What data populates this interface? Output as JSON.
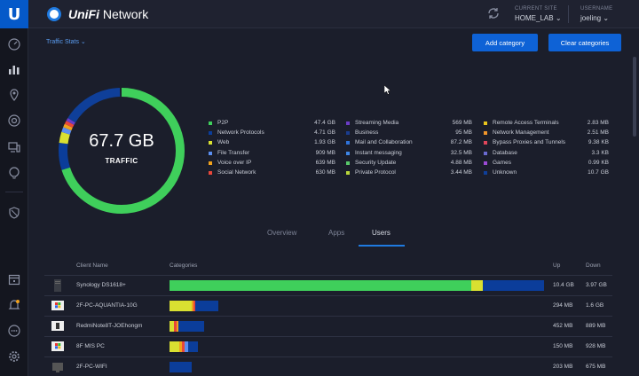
{
  "nav": {
    "logo": "U",
    "icons": [
      "dashboard-icon",
      "statistics-icon",
      "map-icon",
      "devices-icon",
      "clients-icon",
      "insights-icon",
      "shield-icon",
      "events-icon",
      "alerts-icon",
      "chat-icon",
      "settings-icon"
    ]
  },
  "topbar": {
    "brand_italic": "UniFi",
    "brand_rest": " Network",
    "site_label": "CURRENT SITE",
    "site_value": "HOME_LAB",
    "user_label": "USERNAME",
    "user_value": "joeling"
  },
  "subhead": {
    "stats_dropdown": "Traffic Stats",
    "add_category": "Add category",
    "clear_categories": "Clear categories"
  },
  "donut": {
    "total": "67.7 GB",
    "label": "TRAFFIC"
  },
  "colors": {
    "p2p": "#3fcf5b",
    "network_protocols": "#0b3d9a",
    "web": "#d9e031",
    "file_transfer": "#5a8ef0",
    "voice_over_ip": "#f0a11c",
    "social_network": "#e8473a",
    "streaming_media": "#6b3cc6",
    "business": "#5a2cb8",
    "mail": "#2e72d9",
    "instant_messaging": "#3e86e6",
    "security_update": "#58c86a",
    "private_protocol": "#b8d63a",
    "remote_access": "#e8c41c",
    "network_management": "#f0952a",
    "bypass_proxies": "#e0455a",
    "database": "#6a6ad0",
    "games": "#9c4ad6",
    "unknown": "#0f3f99"
  },
  "legend": [
    [
      {
        "name": "P2P",
        "value": "47.4 GB",
        "color": "#3fcf5b"
      },
      {
        "name": "Network Protocols",
        "value": "4.71 GB",
        "color": "#0b3d9a"
      },
      {
        "name": "Web",
        "value": "1.93 GB",
        "color": "#d9e031"
      },
      {
        "name": "File Transfer",
        "value": "909 MB",
        "color": "#5a8ef0"
      },
      {
        "name": "Voice over IP",
        "value": "639 MB",
        "color": "#f0a11c"
      },
      {
        "name": "Social Network",
        "value": "630 MB",
        "color": "#e8473a"
      }
    ],
    [
      {
        "name": "Streaming Media",
        "value": "569 MB",
        "color": "#6b3cc6"
      },
      {
        "name": "Business",
        "value": "95 MB",
        "color": "#1a3c8e"
      },
      {
        "name": "Mail and Collaboration",
        "value": "87.2 MB",
        "color": "#2e72d9"
      },
      {
        "name": "Instant messaging",
        "value": "32.5 MB",
        "color": "#3e86e6"
      },
      {
        "name": "Security Update",
        "value": "4.88 MB",
        "color": "#58c86a"
      },
      {
        "name": "Private Protocol",
        "value": "3.44 MB",
        "color": "#b8d63a"
      }
    ],
    [
      {
        "name": "Remote Access Terminals",
        "value": "2.83 MB",
        "color": "#e8c41c"
      },
      {
        "name": "Network Management",
        "value": "2.51 MB",
        "color": "#f0952a"
      },
      {
        "name": "Bypass Proxies and Tunnels",
        "value": "9.38 KB",
        "color": "#e0455a"
      },
      {
        "name": "Database",
        "value": "3.3 KB",
        "color": "#6a6ad0"
      },
      {
        "name": "Games",
        "value": "0.99 KB",
        "color": "#9c4ad6"
      },
      {
        "name": "Unknown",
        "value": "10.7 GB",
        "color": "#0f3f99"
      }
    ]
  ],
  "tabs": [
    "Overview",
    "Apps",
    "Users"
  ],
  "active_tab": "Users",
  "table": {
    "headers": {
      "client": "Client Name",
      "categories": "Categories",
      "up": "Up",
      "down": "Down"
    },
    "rows": [
      {
        "name": "Synology DS1618+",
        "up": "10.4 GB",
        "down": "3.97 GB",
        "segments": [
          {
            "color": "#3fcf5b",
            "share": 0.806
          },
          {
            "color": "#d9e031",
            "share": 0.03
          },
          {
            "color": "#0b3d9a",
            "share": 0.164
          }
        ],
        "length": 1.0
      },
      {
        "name": "2F-PC-AQUANTIA-10G",
        "up": "294 MB",
        "down": "1.6 GB",
        "segments": [
          {
            "color": "#d9e031",
            "share": 0.45
          },
          {
            "color": "#f0a11c",
            "share": 0.04
          },
          {
            "color": "#e8473a",
            "share": 0.04
          },
          {
            "color": "#0b3d9a",
            "share": 0.47
          }
        ],
        "length": 0.13
      },
      {
        "name": "RedmiNote8T-JOEhongm",
        "up": "452 MB",
        "down": "889 MB",
        "segments": [
          {
            "color": "#d9e031",
            "share": 0.12
          },
          {
            "color": "#e8473a",
            "share": 0.08
          },
          {
            "color": "#f0a11c",
            "share": 0.05
          },
          {
            "color": "#0b3d9a",
            "share": 0.75
          }
        ],
        "length": 0.093
      },
      {
        "name": "8F MIS PC",
        "up": "150 MB",
        "down": "928 MB",
        "segments": [
          {
            "color": "#d9e031",
            "share": 0.35
          },
          {
            "color": "#f0a11c",
            "share": 0.1
          },
          {
            "color": "#e8473a",
            "share": 0.1
          },
          {
            "color": "#5a8ef0",
            "share": 0.1
          },
          {
            "color": "#0b3d9a",
            "share": 0.35
          }
        ],
        "length": 0.075
      },
      {
        "name": "2F-PC-WIFI",
        "up": "203 MB",
        "down": "675 MB",
        "segments": [
          {
            "color": "#0b3d9a",
            "share": 1.0
          }
        ],
        "length": 0.06
      }
    ]
  },
  "donut_segments": [
    {
      "color": "#3fcf5b",
      "share": 0.7
    },
    {
      "color": "#0b3d9a",
      "share": 0.07
    },
    {
      "color": "#d9e031",
      "share": 0.028
    },
    {
      "color": "#5a8ef0",
      "share": 0.013
    },
    {
      "color": "#f0a11c",
      "share": 0.009
    },
    {
      "color": "#e8473a",
      "share": 0.009
    },
    {
      "color": "#6b3cc6",
      "share": 0.008
    },
    {
      "color": "#0f3f99",
      "share": 0.158
    }
  ]
}
